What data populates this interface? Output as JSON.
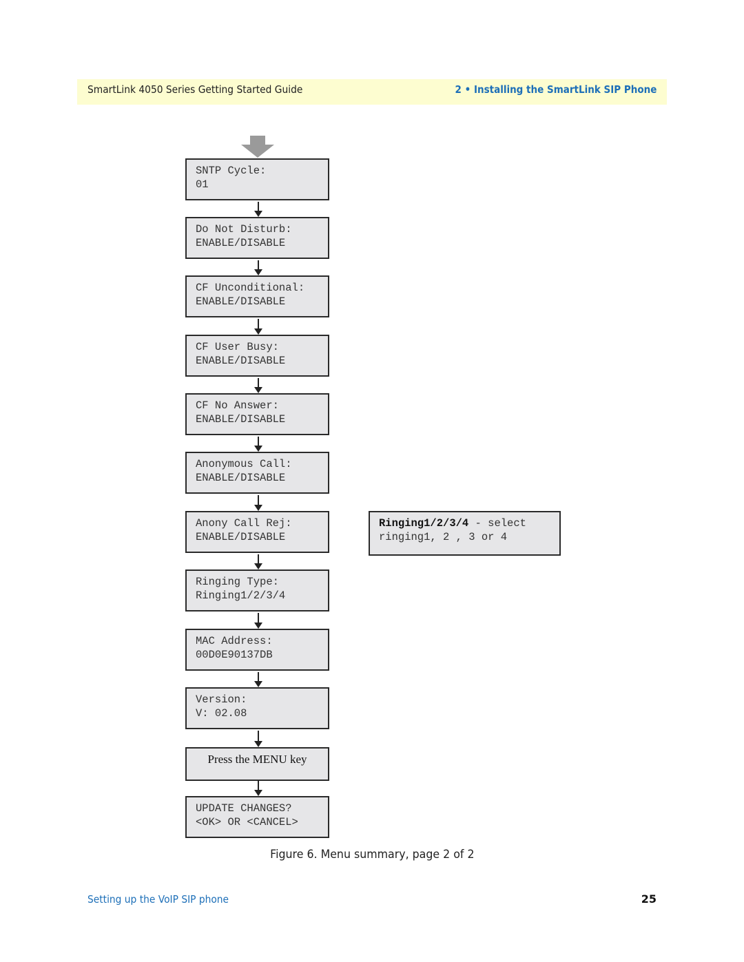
{
  "header": {
    "guide_title": "SmartLink 4050 Series Getting Started Guide",
    "chapter_title": "2 • Installing the SmartLink SIP Phone"
  },
  "colors": {
    "header_band": "#fdfdd0",
    "accent_blue": "#1d6fb8",
    "box_fill": "#e6e6e8",
    "box_border": "#2a2a2a",
    "entry_arrow": "#9a9a9a"
  },
  "flowchart": {
    "entry_icon": "down-arrow-icon",
    "steps": [
      {
        "line1": "SNTP Cycle:",
        "line2": "01"
      },
      {
        "line1": "Do Not Disturb:",
        "line2": "ENABLE/DISABLE"
      },
      {
        "line1": "CF Unconditional:",
        "line2": "ENABLE/DISABLE"
      },
      {
        "line1": "CF User Busy:",
        "line2": "ENABLE/DISABLE"
      },
      {
        "line1": "CF No Answer:",
        "line2": "ENABLE/DISABLE"
      },
      {
        "line1": "Anonymous Call:",
        "line2": "ENABLE/DISABLE"
      },
      {
        "line1": "Anony Call Rej:",
        "line2": "ENABLE/DISABLE"
      },
      {
        "line1": "Ringing Type:",
        "line2": "Ringing1/2/3/4"
      },
      {
        "line1": "MAC Address:",
        "line2": "00D0E90137DB"
      },
      {
        "line1": "Version:",
        "line2": "V: 02.08"
      },
      {
        "line1": "Press the MENU key",
        "line2": ""
      },
      {
        "line1": "UPDATE CHANGES?",
        "line2": "<OK> OR <CANCEL>"
      }
    ],
    "note": {
      "bold": "Ringing1/2/3/4",
      "rest": " - select",
      "line2": "ringing1, 2 , 3 or 4"
    }
  },
  "caption": "Figure 6. Menu summary, page 2 of 2",
  "footer": {
    "section": "Setting up the VoIP SIP phone",
    "page_number": "25"
  }
}
